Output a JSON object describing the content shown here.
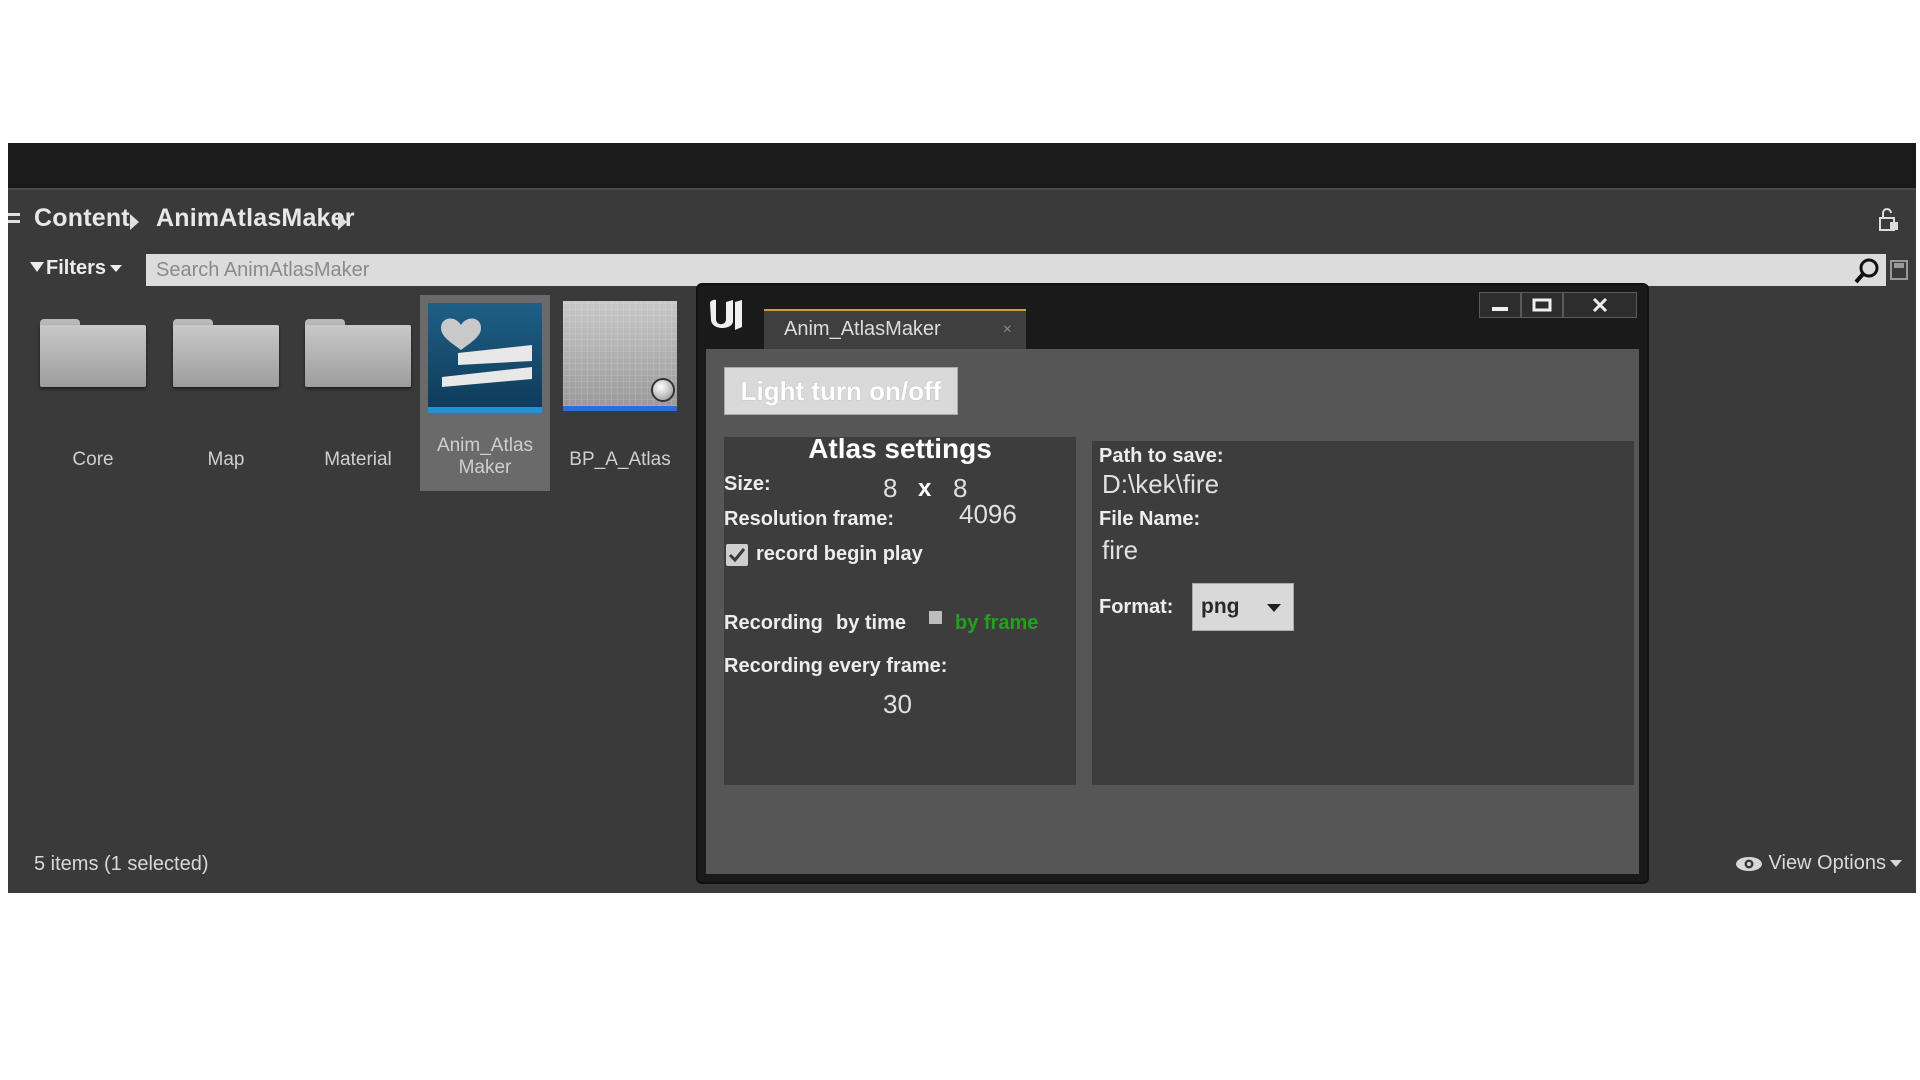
{
  "breadcrumb": {
    "items": [
      "Content",
      "AnimAtlasMaker"
    ]
  },
  "toolbar": {
    "filters_label": "Filters"
  },
  "search": {
    "placeholder": "Search AnimAtlasMaker"
  },
  "assets": [
    {
      "label": "Core",
      "type": "folder"
    },
    {
      "label": "Map",
      "type": "folder"
    },
    {
      "label": "Material",
      "type": "folder"
    },
    {
      "label_line1": "Anim_Atlas",
      "label_line2": "Maker",
      "type": "widget",
      "selected": true
    },
    {
      "label": "BP_A_Atlas",
      "type": "blueprint"
    }
  ],
  "status": {
    "items_text": "5 items (1 selected)",
    "view_options_label": "View Options"
  },
  "window": {
    "tab_label": "Anim_AtlasMaker",
    "tab_close": "×",
    "light_button_label": "Light turn on/off",
    "atlas": {
      "title": "Atlas settings",
      "size_label": "Size:",
      "size_w": "8",
      "size_x": "x",
      "size_h": "8",
      "resolution_label": "Resolution frame:",
      "resolution_value": "4096",
      "record_begin_play_label": "record begin play",
      "record_begin_play_checked": true,
      "recording_label": "Recording",
      "by_time_label": "by time",
      "by_frame_label": "by frame",
      "recording_every_label": "Recording every frame:",
      "recording_every_value": "30"
    },
    "save": {
      "path_label": "Path to save:",
      "path_value": "D:\\kek\\fire",
      "filename_label": "File Name:",
      "filename_value": "fire",
      "format_label": "Format:",
      "format_value": "png"
    }
  },
  "colors": {
    "accent_green": "#22a01e",
    "tab_accent": "#c8a23a",
    "selection_blue": "#2a8fd2"
  }
}
